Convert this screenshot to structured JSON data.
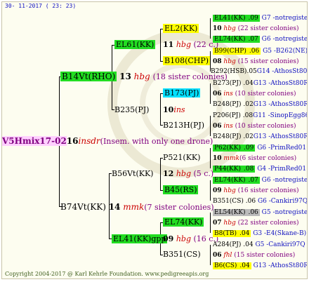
{
  "header": {
    "date": "30- 11-2017 ( 23: 23)"
  },
  "footer": {
    "copyright": "Copyright 2004-2017 @ Karl Kehrle Foundation.   www.pedigreeapis.org"
  },
  "root": {
    "id": "V5Hmix17-02",
    "gen": "16",
    "mark": "insdr",
    "note": "(Insem. with only one drone)"
  },
  "gen1": {
    "top": {
      "id": "B14Vt(RHO)",
      "num": "13",
      "mark": "hbg",
      "note": "(18 sister colonies)"
    },
    "bottom": {
      "id": "B74Vt(KK)",
      "num": "14",
      "mark": "mmk",
      "note": "(7 sister colonies)"
    }
  },
  "gen2": [
    {
      "id": "EL61(KK)",
      "num": "11",
      "mark": "hbg",
      "note": "(22 c.)"
    },
    {
      "id": "B235(PJ)",
      "num": "10",
      "mark": "ins",
      "note": ""
    },
    {
      "id": "B56Vt(KK)",
      "num": "12",
      "mark": "hbg",
      "note": "(5 c.)"
    },
    {
      "id": "EL41(KK)gpp",
      "num": "09",
      "mark": "hbg",
      "note": "(16 c.)"
    }
  ],
  "gen3": [
    {
      "id": "EL2(KK)"
    },
    {
      "id": "B108(CHP)"
    },
    {
      "id": "B173(PJ)"
    },
    {
      "id": "B213H(PJ)"
    },
    {
      "id": "P521(KK)"
    },
    {
      "id": "B45(RS)"
    },
    {
      "id": "EL74(KK)"
    },
    {
      "id": "B351(CS)"
    }
  ],
  "gen4": [
    {
      "id": "EL41(KK)",
      "code": ".09",
      "desc": "G7 -notregiste"
    },
    {
      "num": "10",
      "mark": "hbg",
      "note": "(22 sister colonies)"
    },
    {
      "id": "EL74(KK)",
      "code": ".07",
      "desc": "G6 -notregiste"
    },
    {
      "id": "B99(CHP)",
      "code": ".06",
      "desc": "G5 -B262(NE)"
    },
    {
      "num": "08",
      "mark": "hbg",
      "note": "(15 sister colonies)"
    },
    {
      "id": "B292(HSB)",
      "code": ".05",
      "desc": "G14 -AthosSt80R"
    },
    {
      "id": "B273(PJ)",
      "code": ".04",
      "desc": "G13 -AthosSt80R"
    },
    {
      "num": "06",
      "mark": "ins",
      "note": "(10 sister colonies)"
    },
    {
      "id": "B248(PJ)",
      "code": ".02",
      "desc": "G13 -AthosSt80R"
    },
    {
      "id": "P206(PJ)",
      "code": ".08",
      "desc": "G11 -SinopEgg86R"
    },
    {
      "num": "06",
      "mark": "ins",
      "note": "(10 sister colonies)"
    },
    {
      "id": "B248(PJ)",
      "code": ".02",
      "desc": "G13 -AthosSt80R"
    },
    {
      "id": "P62(KK)",
      "code": ".09",
      "desc": "G6 -PrimRed01"
    },
    {
      "num": "10",
      "mark": "mmk",
      "note": "(6 sister colonies)"
    },
    {
      "id": "P44(KK)",
      "code": ".08",
      "desc": "G4 -PrimRed01"
    },
    {
      "id": "EL74(KK)",
      "code": ".07",
      "desc": "G6 -notregiste"
    },
    {
      "num": "09",
      "mark": "hbg",
      "note": "(16 sister colonies)"
    },
    {
      "id": "B351(CS)",
      "code": ".06",
      "desc": "G6 -Cankiri97Q"
    },
    {
      "id": "EL54(KK)",
      "code": ".06",
      "desc": "G5 -notregiste"
    },
    {
      "num": "07",
      "mark": "hbg",
      "note": "(22 sister colonies)"
    },
    {
      "id": "B8(TB)",
      "code": ".04",
      "desc": "G3 -E4(Skane-B)"
    },
    {
      "id": "A284(PJ)",
      "code": ".04",
      "desc": "G5 -Cankiri97Q"
    },
    {
      "num": "06",
      "mark": "fhl",
      "note": "(15 sister colonies)"
    },
    {
      "id": "B6(CS)",
      "code": ".04",
      "desc": "G13 -AthosSt80R"
    }
  ]
}
